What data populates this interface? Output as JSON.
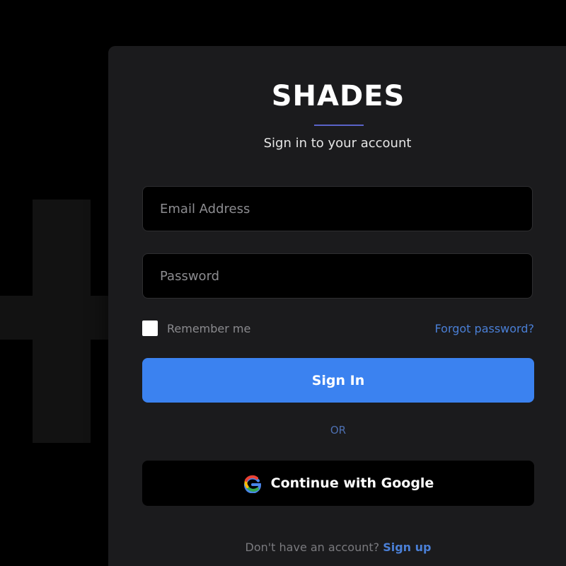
{
  "brand": {
    "name": "SHADES",
    "accent_color": "#5a63c8"
  },
  "login": {
    "subtitle": "Sign in to your account",
    "email_placeholder": "Email Address",
    "email_value": "",
    "password_placeholder": "Password",
    "password_value": "",
    "remember_label": "Remember me",
    "remember_checked": false,
    "forgot_label": "Forgot password?",
    "signin_label": "Sign In",
    "signin_color": "#3b82f0",
    "or_label": "OR",
    "google_label": "Continue with Google",
    "google_icon": "google-icon",
    "signup_prompt": "Don't have an account?",
    "signup_label": "Sign up",
    "link_color": "#4a7fd6"
  }
}
